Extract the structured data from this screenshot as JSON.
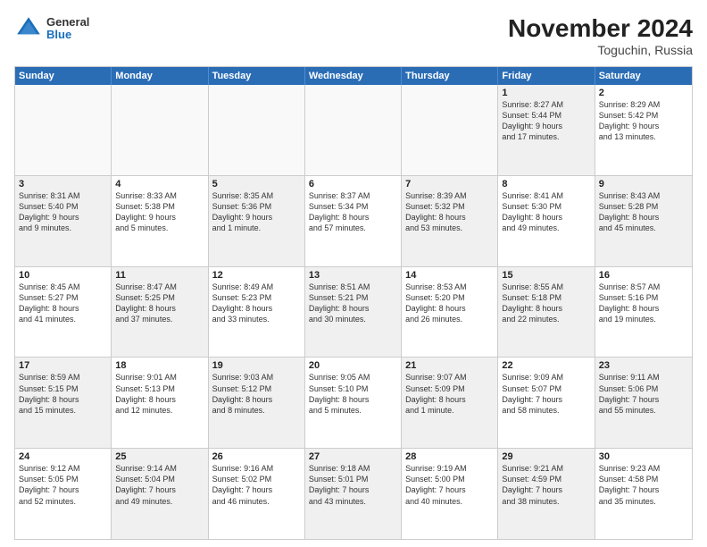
{
  "logo": {
    "general": "General",
    "blue": "Blue"
  },
  "title": "November 2024",
  "subtitle": "Toguchin, Russia",
  "header_days": [
    "Sunday",
    "Monday",
    "Tuesday",
    "Wednesday",
    "Thursday",
    "Friday",
    "Saturday"
  ],
  "rows": [
    [
      {
        "day": "",
        "text": "",
        "empty": true
      },
      {
        "day": "",
        "text": "",
        "empty": true
      },
      {
        "day": "",
        "text": "",
        "empty": true
      },
      {
        "day": "",
        "text": "",
        "empty": true
      },
      {
        "day": "",
        "text": "",
        "empty": true
      },
      {
        "day": "1",
        "text": "Sunrise: 8:27 AM\nSunset: 5:44 PM\nDaylight: 9 hours\nand 17 minutes.",
        "shaded": true
      },
      {
        "day": "2",
        "text": "Sunrise: 8:29 AM\nSunset: 5:42 PM\nDaylight: 9 hours\nand 13 minutes.",
        "shaded": false
      }
    ],
    [
      {
        "day": "3",
        "text": "Sunrise: 8:31 AM\nSunset: 5:40 PM\nDaylight: 9 hours\nand 9 minutes.",
        "shaded": true
      },
      {
        "day": "4",
        "text": "Sunrise: 8:33 AM\nSunset: 5:38 PM\nDaylight: 9 hours\nand 5 minutes.",
        "shaded": false
      },
      {
        "day": "5",
        "text": "Sunrise: 8:35 AM\nSunset: 5:36 PM\nDaylight: 9 hours\nand 1 minute.",
        "shaded": true
      },
      {
        "day": "6",
        "text": "Sunrise: 8:37 AM\nSunset: 5:34 PM\nDaylight: 8 hours\nand 57 minutes.",
        "shaded": false
      },
      {
        "day": "7",
        "text": "Sunrise: 8:39 AM\nSunset: 5:32 PM\nDaylight: 8 hours\nand 53 minutes.",
        "shaded": true
      },
      {
        "day": "8",
        "text": "Sunrise: 8:41 AM\nSunset: 5:30 PM\nDaylight: 8 hours\nand 49 minutes.",
        "shaded": false
      },
      {
        "day": "9",
        "text": "Sunrise: 8:43 AM\nSunset: 5:28 PM\nDaylight: 8 hours\nand 45 minutes.",
        "shaded": true
      }
    ],
    [
      {
        "day": "10",
        "text": "Sunrise: 8:45 AM\nSunset: 5:27 PM\nDaylight: 8 hours\nand 41 minutes.",
        "shaded": false
      },
      {
        "day": "11",
        "text": "Sunrise: 8:47 AM\nSunset: 5:25 PM\nDaylight: 8 hours\nand 37 minutes.",
        "shaded": true
      },
      {
        "day": "12",
        "text": "Sunrise: 8:49 AM\nSunset: 5:23 PM\nDaylight: 8 hours\nand 33 minutes.",
        "shaded": false
      },
      {
        "day": "13",
        "text": "Sunrise: 8:51 AM\nSunset: 5:21 PM\nDaylight: 8 hours\nand 30 minutes.",
        "shaded": true
      },
      {
        "day": "14",
        "text": "Sunrise: 8:53 AM\nSunset: 5:20 PM\nDaylight: 8 hours\nand 26 minutes.",
        "shaded": false
      },
      {
        "day": "15",
        "text": "Sunrise: 8:55 AM\nSunset: 5:18 PM\nDaylight: 8 hours\nand 22 minutes.",
        "shaded": true
      },
      {
        "day": "16",
        "text": "Sunrise: 8:57 AM\nSunset: 5:16 PM\nDaylight: 8 hours\nand 19 minutes.",
        "shaded": false
      }
    ],
    [
      {
        "day": "17",
        "text": "Sunrise: 8:59 AM\nSunset: 5:15 PM\nDaylight: 8 hours\nand 15 minutes.",
        "shaded": true
      },
      {
        "day": "18",
        "text": "Sunrise: 9:01 AM\nSunset: 5:13 PM\nDaylight: 8 hours\nand 12 minutes.",
        "shaded": false
      },
      {
        "day": "19",
        "text": "Sunrise: 9:03 AM\nSunset: 5:12 PM\nDaylight: 8 hours\nand 8 minutes.",
        "shaded": true
      },
      {
        "day": "20",
        "text": "Sunrise: 9:05 AM\nSunset: 5:10 PM\nDaylight: 8 hours\nand 5 minutes.",
        "shaded": false
      },
      {
        "day": "21",
        "text": "Sunrise: 9:07 AM\nSunset: 5:09 PM\nDaylight: 8 hours\nand 1 minute.",
        "shaded": true
      },
      {
        "day": "22",
        "text": "Sunrise: 9:09 AM\nSunset: 5:07 PM\nDaylight: 7 hours\nand 58 minutes.",
        "shaded": false
      },
      {
        "day": "23",
        "text": "Sunrise: 9:11 AM\nSunset: 5:06 PM\nDaylight: 7 hours\nand 55 minutes.",
        "shaded": true
      }
    ],
    [
      {
        "day": "24",
        "text": "Sunrise: 9:12 AM\nSunset: 5:05 PM\nDaylight: 7 hours\nand 52 minutes.",
        "shaded": false
      },
      {
        "day": "25",
        "text": "Sunrise: 9:14 AM\nSunset: 5:04 PM\nDaylight: 7 hours\nand 49 minutes.",
        "shaded": true
      },
      {
        "day": "26",
        "text": "Sunrise: 9:16 AM\nSunset: 5:02 PM\nDaylight: 7 hours\nand 46 minutes.",
        "shaded": false
      },
      {
        "day": "27",
        "text": "Sunrise: 9:18 AM\nSunset: 5:01 PM\nDaylight: 7 hours\nand 43 minutes.",
        "shaded": true
      },
      {
        "day": "28",
        "text": "Sunrise: 9:19 AM\nSunset: 5:00 PM\nDaylight: 7 hours\nand 40 minutes.",
        "shaded": false
      },
      {
        "day": "29",
        "text": "Sunrise: 9:21 AM\nSunset: 4:59 PM\nDaylight: 7 hours\nand 38 minutes.",
        "shaded": true
      },
      {
        "day": "30",
        "text": "Sunrise: 9:23 AM\nSunset: 4:58 PM\nDaylight: 7 hours\nand 35 minutes.",
        "shaded": false
      }
    ]
  ]
}
